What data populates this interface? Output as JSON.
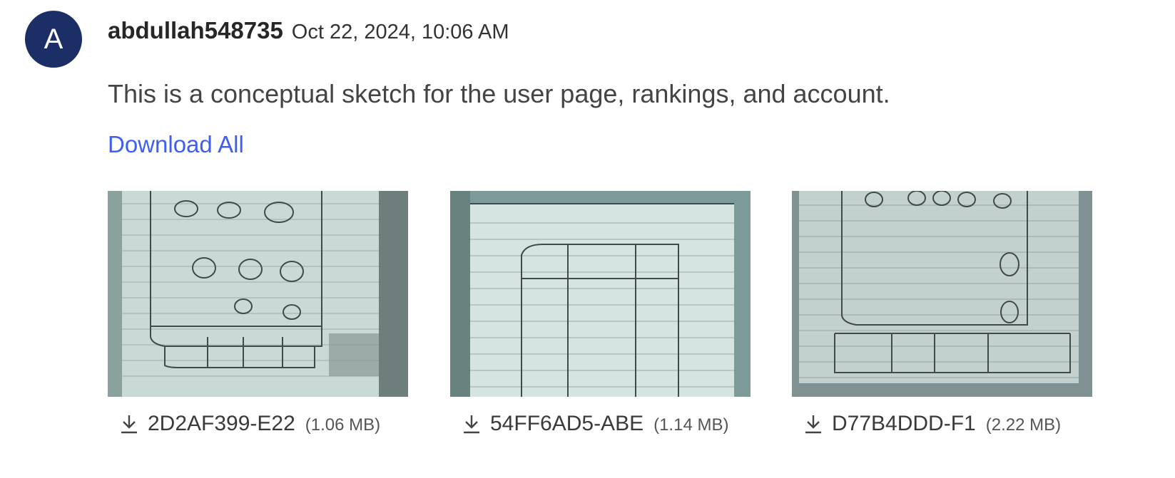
{
  "author": {
    "avatar_letter": "A",
    "avatar_color": "#1b2f66",
    "username": "abdullah548735",
    "timestamp": "Oct 22, 2024, 10:06 AM"
  },
  "message": "This is a conceptual sketch for the user page, rankings, and account.",
  "download_all_label": "Download All",
  "link_color": "#3f5ef2",
  "attachments": [
    {
      "filename": "2D2AF399-E22",
      "size": "(1.06 MB)",
      "icon": "download-icon"
    },
    {
      "filename": "54FF6AD5-ABE",
      "size": "(1.14 MB)",
      "icon": "download-icon"
    },
    {
      "filename": "D77B4DDD-F1",
      "size": "(2.22 MB)",
      "icon": "download-icon"
    }
  ]
}
